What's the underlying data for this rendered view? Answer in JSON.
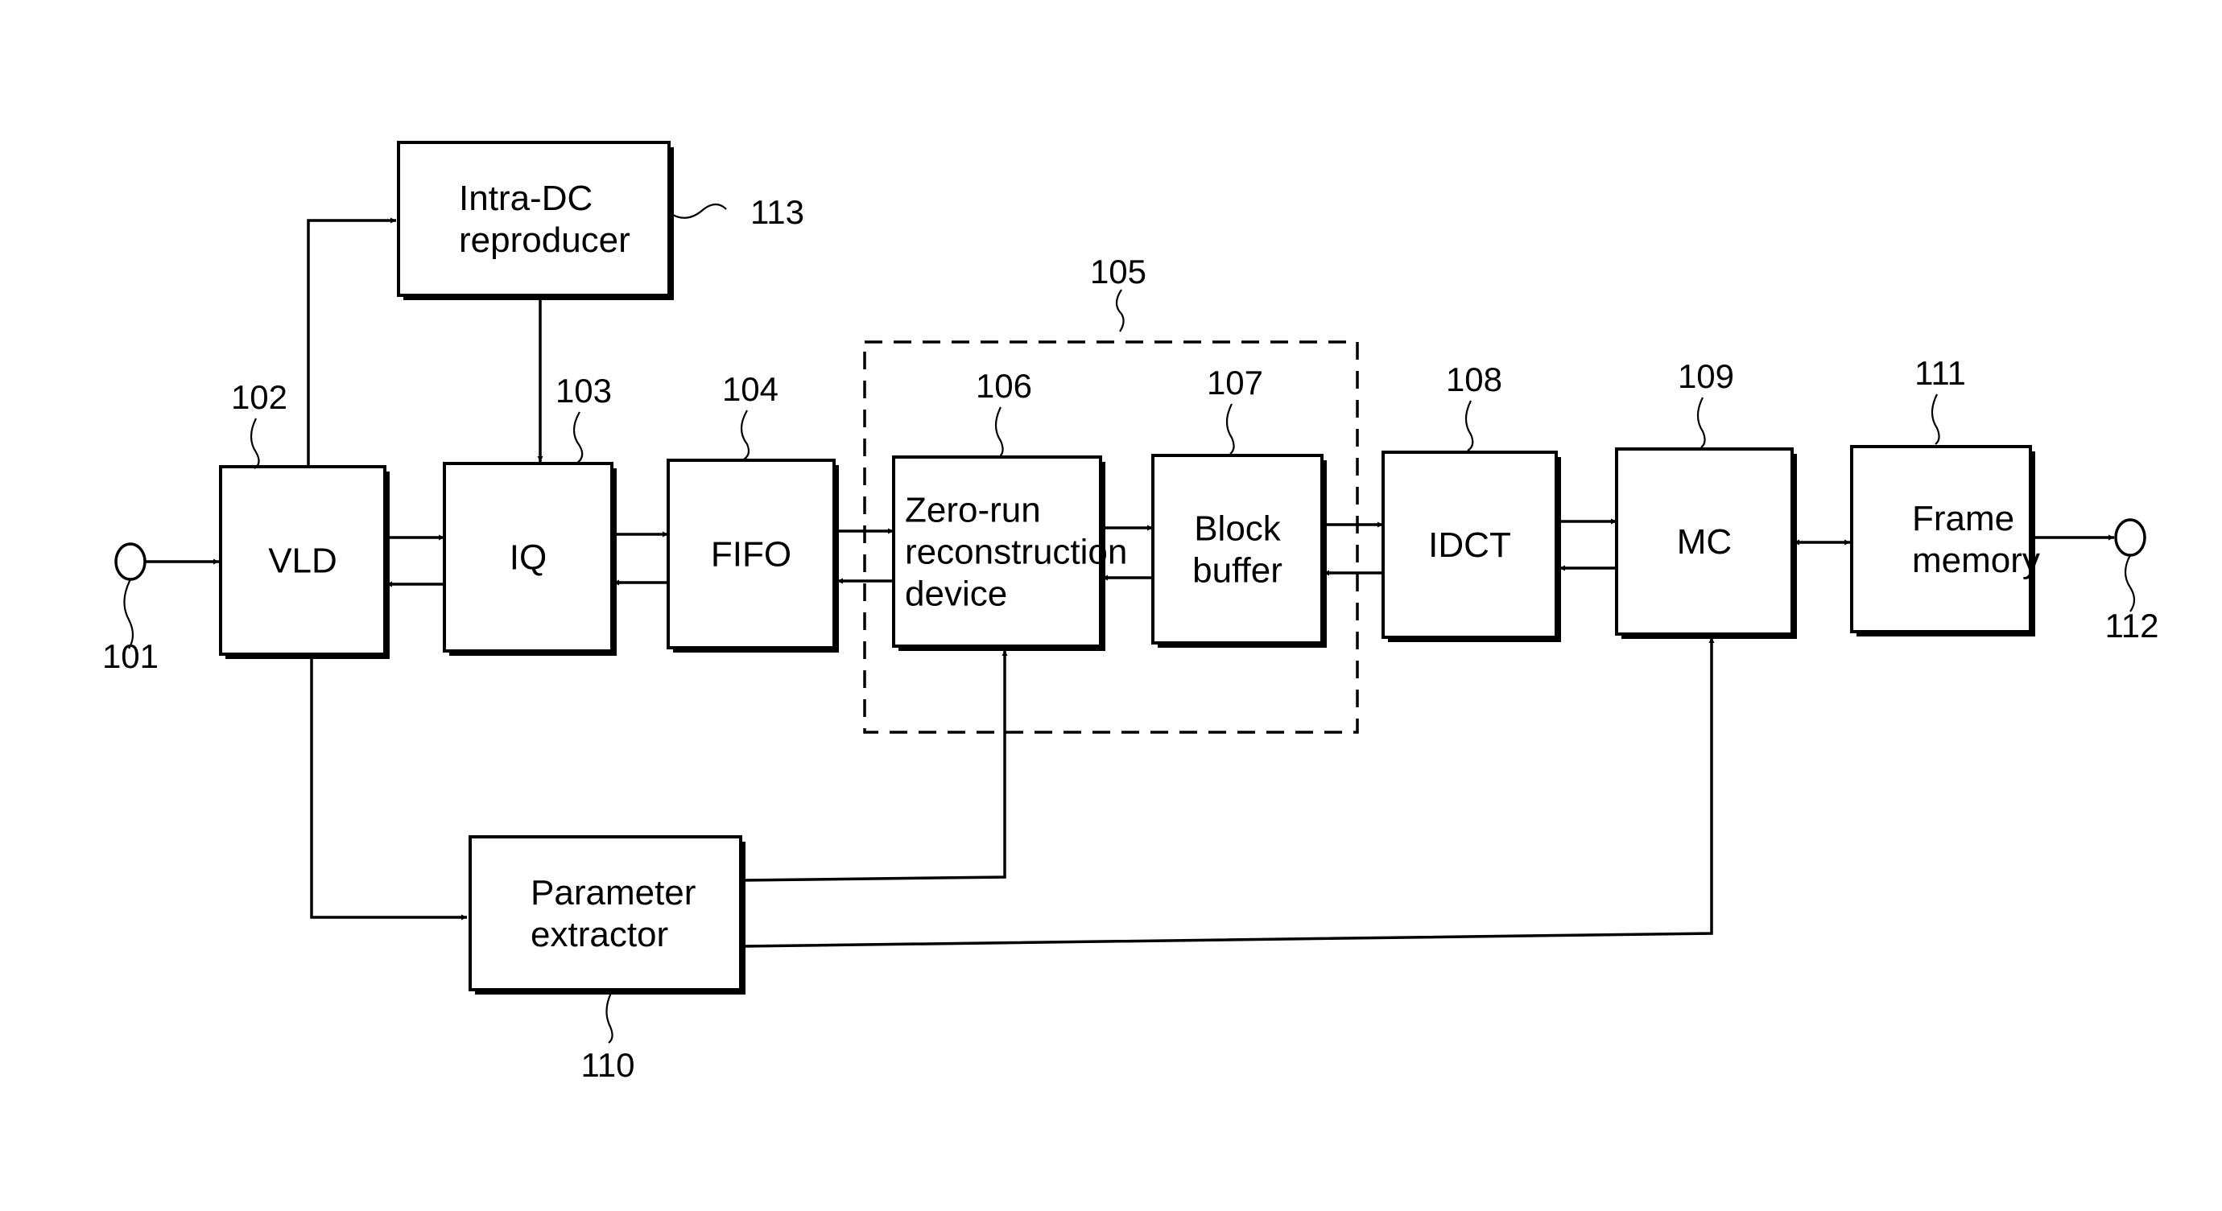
{
  "diagram": {
    "blocks": [
      {
        "id": "vld",
        "ref": "102",
        "lines": [
          "VLD"
        ]
      },
      {
        "id": "iq",
        "ref": "103",
        "lines": [
          "IQ"
        ]
      },
      {
        "id": "fifo",
        "ref": "104",
        "lines": [
          "FIFO"
        ]
      },
      {
        "id": "zero_run",
        "ref": "106",
        "lines": [
          "Zero-run",
          "reconstruction",
          "device"
        ]
      },
      {
        "id": "block_buffer",
        "ref": "107",
        "lines": [
          "Block",
          "buffer"
        ]
      },
      {
        "id": "idct",
        "ref": "108",
        "lines": [
          "IDCT"
        ]
      },
      {
        "id": "mc",
        "ref": "109",
        "lines": [
          "MC"
        ]
      },
      {
        "id": "frame_memory",
        "ref": "111",
        "lines": [
          "Frame",
          "memory"
        ]
      },
      {
        "id": "intra_dc",
        "ref": "113",
        "lines": [
          "Intra-DC",
          "reproducer"
        ]
      },
      {
        "id": "param_extractor",
        "ref": "110",
        "lines": [
          "Parameter",
          "extractor"
        ]
      }
    ],
    "group": {
      "id": "zero_run_group",
      "ref": "105"
    },
    "terminals": [
      {
        "id": "input",
        "ref": "101"
      },
      {
        "id": "output",
        "ref": "112"
      }
    ],
    "connections": [
      {
        "from": "101",
        "to": "VLD"
      },
      {
        "from": "VLD",
        "to": "IQ",
        "bidirectional": true
      },
      {
        "from": "IQ",
        "to": "FIFO",
        "bidirectional": true
      },
      {
        "from": "FIFO",
        "to": "Zero-run reconstruction device",
        "bidirectional": true
      },
      {
        "from": "Zero-run reconstruction device",
        "to": "Block buffer",
        "bidirectional": true
      },
      {
        "from": "Block buffer",
        "to": "IDCT",
        "bidirectional": true
      },
      {
        "from": "IDCT",
        "to": "MC",
        "bidirectional": true
      },
      {
        "from": "MC",
        "to": "Frame memory",
        "bidirectional": true
      },
      {
        "from": "Frame memory",
        "to": "112"
      },
      {
        "from": "VLD",
        "to": "Intra-DC reproducer"
      },
      {
        "from": "Intra-DC reproducer",
        "to": "IQ"
      },
      {
        "from": "VLD",
        "to": "Parameter extractor"
      },
      {
        "from": "Parameter extractor",
        "to": "Zero-run reconstruction device"
      },
      {
        "from": "Parameter extractor",
        "to": "MC"
      }
    ]
  }
}
